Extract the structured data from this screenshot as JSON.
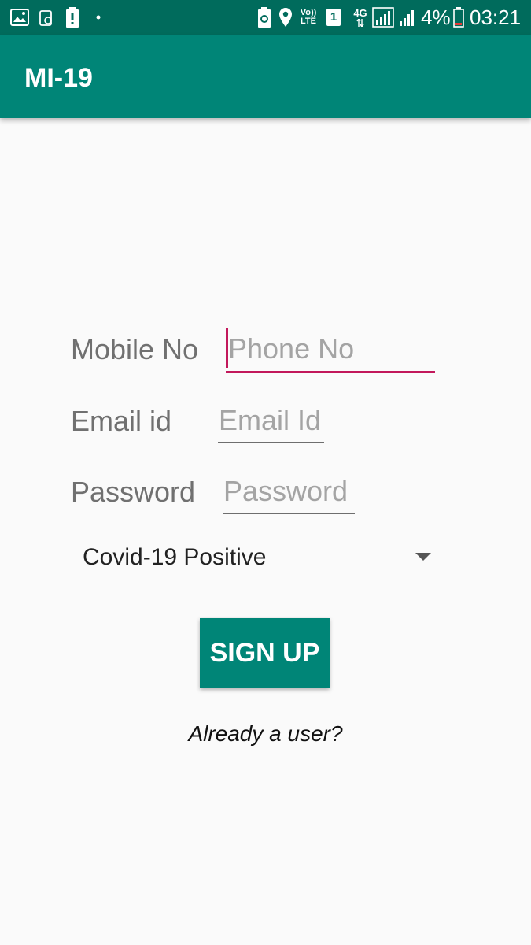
{
  "status_bar": {
    "icons": [
      "image-icon",
      "recycle-tray-icon",
      "battery-alert-icon",
      "dot-icon",
      "battery-saver-icon",
      "location-pin-icon",
      "volte-icon",
      "sim-1-icon",
      "data-4g-icon",
      "signal-strength-icon",
      "signal-strength-2-icon",
      "battery-icon"
    ],
    "volte_label": "Vo))\nLTE",
    "sim_label": "1",
    "network_label": "4G",
    "battery_percent": "4%",
    "time": "03:21"
  },
  "app_bar": {
    "title": "MI-19"
  },
  "form": {
    "mobile_label": "Mobile No",
    "mobile_placeholder": "Phone No",
    "email_label": "Email id",
    "email_placeholder": "Email Id",
    "password_label": "Password",
    "password_placeholder": "Password",
    "status_selected": "Covid-19 Positive",
    "signup_label": "SIGN UP",
    "login_link": "Already a user?"
  },
  "colors": {
    "status_bar": "#006b5c",
    "primary": "#008577",
    "accent": "#c2185b",
    "background": "#fafafa"
  }
}
